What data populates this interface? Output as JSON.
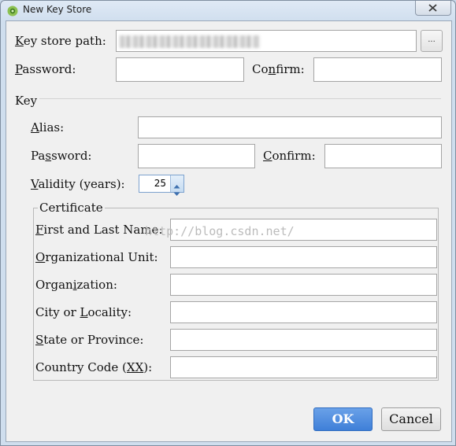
{
  "window": {
    "title": "New Key Store",
    "close_icon": "close-icon",
    "app_icon": "android-studio-icon"
  },
  "keystore": {
    "path_label_prefix": "K",
    "path_label_rest": "ey store path:",
    "path_value": "",
    "browse_label": "...",
    "password_label_prefix": "P",
    "password_label_rest": "assword:",
    "confirm_label_a": "Co",
    "confirm_label_u": "n",
    "confirm_label_b": "firm:"
  },
  "key": {
    "group_label": "Key",
    "alias_label_u": "A",
    "alias_label_rest": "lias:",
    "password_label_a": "Pa",
    "password_label_u": "s",
    "password_label_b": "sword:",
    "confirm_label_u": "C",
    "confirm_label_rest": "onfirm:",
    "validity_label_u": "V",
    "validity_label_rest": "alidity (years):",
    "validity_value": "25"
  },
  "certificate": {
    "group_label": "Certificate",
    "first_last_u": "F",
    "first_last_rest": "irst and Last Name:",
    "org_unit_u": "O",
    "org_unit_rest": "rganizational Unit:",
    "organization_a": "Organ",
    "organization_u": "i",
    "organization_b": "zation:",
    "city_a": "City or ",
    "city_u": "L",
    "city_b": "ocality:",
    "state_u": "S",
    "state_rest": "tate or Province:",
    "country_a": "Country Code (",
    "country_u": "XX",
    "country_b": "):"
  },
  "watermark": "http://blog.csdn.net/",
  "buttons": {
    "ok": "OK",
    "cancel": "Cancel"
  },
  "colors": {
    "ok_button": "#3f7fd8",
    "title_bar": "#dfe9f5",
    "dialog_bg": "#f0f0f0"
  }
}
